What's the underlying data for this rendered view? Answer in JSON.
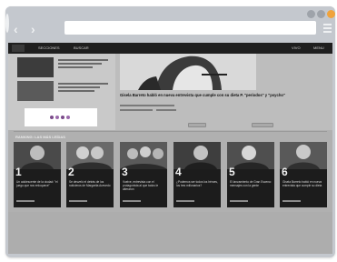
{
  "browser": {
    "controls": [
      "minimize-icon",
      "maximize-icon",
      "close-icon"
    ],
    "nav": {
      "back_icon": "‹",
      "forward_icon": "›"
    },
    "address_placeholder": ""
  },
  "site": {
    "nav_links": [
      "SECCIONES",
      "BUSCAR"
    ],
    "nav_right": [
      "VIVO",
      "MENU"
    ],
    "hero": {
      "title": "Gisela Barreto habló en nueva entrevista que cumple con su dieta P. \"periodos\" y \"psycho\""
    },
    "section_title": "RANKING: LAS MÁS LEÍDAS",
    "cards": [
      {
        "num": "1",
        "text": "Un adolescente de la ciudad: \"el juego que nos enloquece\""
      },
      {
        "num": "2",
        "text": "Se desveló el detrás de los noticieros de Margarita Acevedo"
      },
      {
        "num": "3",
        "text": "Vuelve, entrevista con el protagonista al que todos le alteraron"
      },
      {
        "num": "4",
        "text": "¿Podemos ser todos los héroes, los tres millonarios?"
      },
      {
        "num": "5",
        "text": "El lanzamiento de Gran Escena: mensajes con la gente"
      },
      {
        "num": "6",
        "text": "Gisela Barreto habló en nueva entrevista que cumple su dieta"
      }
    ]
  },
  "colors": {
    "frame": "#c4c8ce",
    "accent_close": "#f0a33c",
    "nav_bar": "#1f1f1f",
    "card_bg": "#1c1c1c"
  }
}
